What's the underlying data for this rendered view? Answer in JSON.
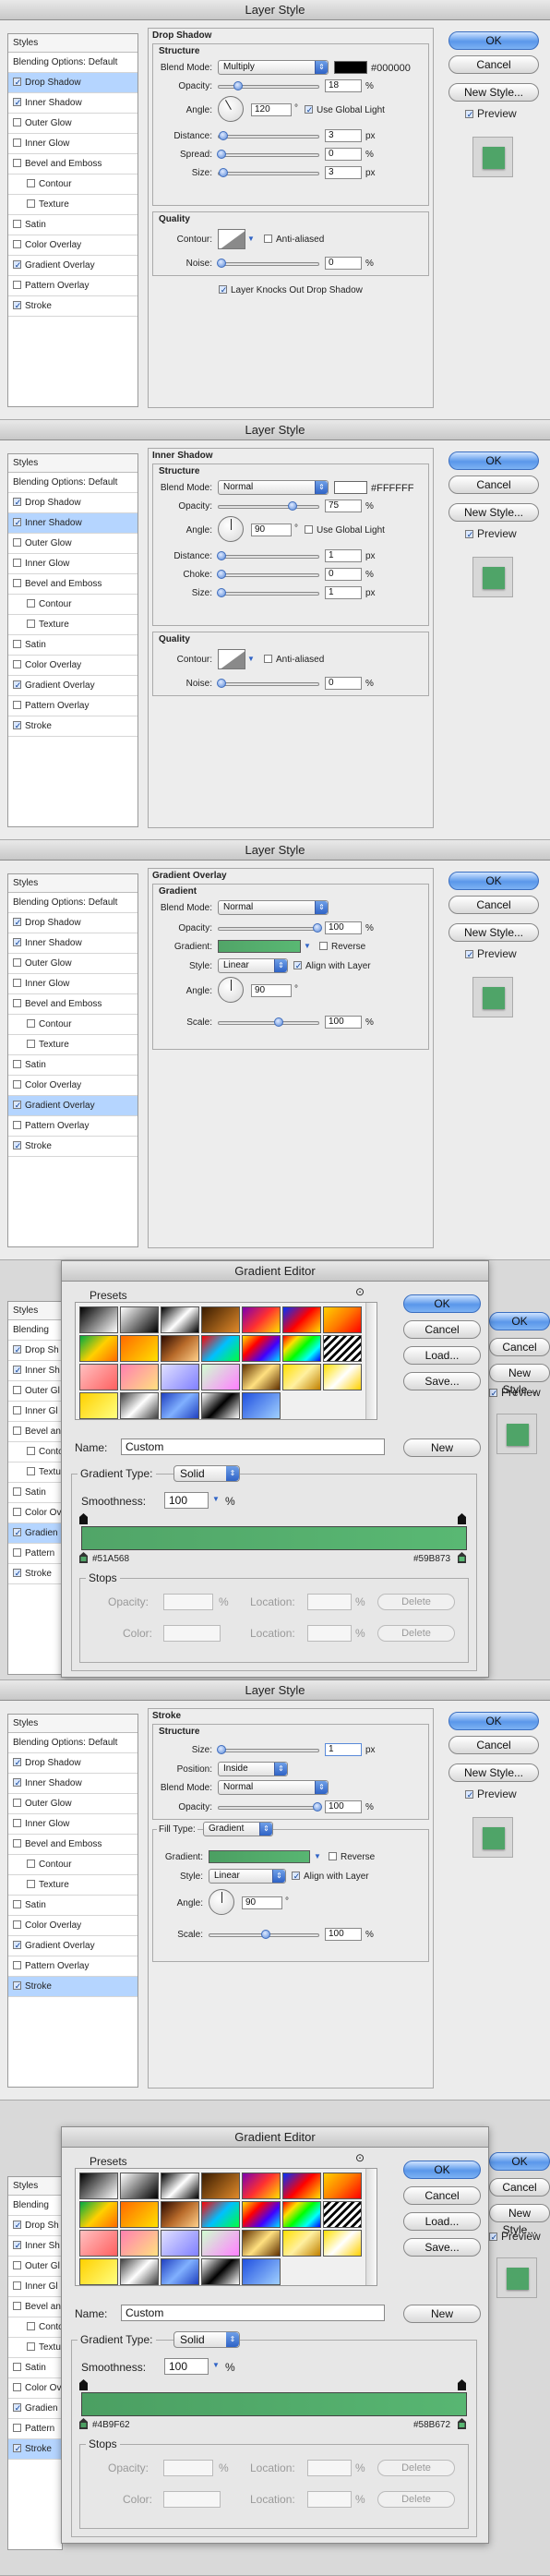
{
  "colors": {
    "green_start": "#51A568",
    "green_end": "#59B873",
    "green_start2": "#4B9F62",
    "green_end2": "#58B672",
    "selection": "#b5d5ff",
    "accent": "#5a97ea"
  },
  "window_title": "Layer Style",
  "styles_list": [
    {
      "label": "Styles",
      "checkbox": false,
      "header": true
    },
    {
      "label": "Blending Options: Default",
      "checkbox": false
    },
    {
      "label": "Drop Shadow",
      "checkbox": true
    },
    {
      "label": "Inner Shadow",
      "checkbox": true
    },
    {
      "label": "Outer Glow",
      "checkbox": true
    },
    {
      "label": "Inner Glow",
      "checkbox": true
    },
    {
      "label": "Bevel and Emboss",
      "checkbox": true
    },
    {
      "label": "Contour",
      "checkbox": true,
      "indent": true
    },
    {
      "label": "Texture",
      "checkbox": true,
      "indent": true
    },
    {
      "label": "Satin",
      "checkbox": true
    },
    {
      "label": "Color Overlay",
      "checkbox": true
    },
    {
      "label": "Gradient Overlay",
      "checkbox": true
    },
    {
      "label": "Pattern Overlay",
      "checkbox": true
    },
    {
      "label": "Stroke",
      "checkbox": true
    }
  ],
  "checked": [
    "Drop Shadow",
    "Inner Shadow",
    "Gradient Overlay",
    "Stroke"
  ],
  "buttons": {
    "ok": "OK",
    "cancel": "Cancel",
    "new_style": "New Style...",
    "preview": "Preview"
  },
  "drop_shadow": {
    "title": "Drop Shadow",
    "structure": "Structure",
    "blend_mode_label": "Blend Mode:",
    "blend_mode": "Multiply",
    "color_hex": "#000000",
    "opacity_label": "Opacity:",
    "opacity": "18",
    "opacity_pct": 18,
    "angle_label": "Angle:",
    "angle": "120",
    "deg": "°",
    "use_global": "Use Global Light",
    "distance_label": "Distance:",
    "distance": "3",
    "spread_label": "Spread:",
    "spread": "0",
    "size_label": "Size:",
    "size": "3",
    "px": "px",
    "pct": "%",
    "quality": "Quality",
    "contour_label": "Contour:",
    "anti_aliased": "Anti-aliased",
    "noise_label": "Noise:",
    "noise": "0",
    "knocks_out": "Layer Knocks Out Drop Shadow"
  },
  "inner_shadow": {
    "title": "Inner Shadow",
    "structure": "Structure",
    "blend_mode_label": "Blend Mode:",
    "blend_mode": "Normal",
    "color_hex": "#FFFFFF",
    "opacity_label": "Opacity:",
    "opacity": "75",
    "opacity_pct": 75,
    "angle_label": "Angle:",
    "angle": "90",
    "deg": "°",
    "use_global": "Use Global Light",
    "distance_label": "Distance:",
    "distance": "1",
    "choke_label": "Choke:",
    "choke": "0",
    "size_label": "Size:",
    "size": "1",
    "px": "px",
    "pct": "%",
    "quality": "Quality",
    "contour_label": "Contour:",
    "anti_aliased": "Anti-aliased",
    "noise_label": "Noise:",
    "noise": "0"
  },
  "gradient_overlay": {
    "title": "Gradient Overlay",
    "gradient_hdr": "Gradient",
    "blend_mode_label": "Blend Mode:",
    "blend_mode": "Normal",
    "opacity_label": "Opacity:",
    "opacity": "100",
    "gradient_label": "Gradient:",
    "reverse": "Reverse",
    "style_label": "Style:",
    "style": "Linear",
    "align": "Align with Layer",
    "angle_label": "Angle:",
    "angle": "90",
    "deg": "°",
    "scale_label": "Scale:",
    "scale": "100",
    "pct": "%"
  },
  "gradient_editor": {
    "title": "Gradient Editor",
    "presets": "Presets",
    "ok": "OK",
    "cancel": "Cancel",
    "load": "Load...",
    "save": "Save...",
    "name_label": "Name:",
    "name": "Custom",
    "new": "New",
    "type_label": "Gradient Type:",
    "type": "Solid",
    "smoothness_label": "Smoothness:",
    "smoothness": "100",
    "pct": "%",
    "stops": "Stops",
    "opacity_label": "Opacity:",
    "location_label": "Location:",
    "color_label": "Color:",
    "delete": "Delete"
  },
  "editor1": {
    "left_stop": "#51A568",
    "right_stop": "#59B873"
  },
  "editor2": {
    "left_stop": "#4B9F62",
    "right_stop": "#58B672"
  },
  "stroke": {
    "title": "Stroke",
    "structure": "Structure",
    "size_label": "Size:",
    "size": "1",
    "px": "px",
    "position_label": "Position:",
    "position": "Inside",
    "blend_mode_label": "Blend Mode:",
    "blend_mode": "Normal",
    "opacity_label": "Opacity:",
    "opacity": "100",
    "pct": "%",
    "fill_type_label": "Fill Type:",
    "fill_type": "Gradient",
    "gradient_label": "Gradient:",
    "reverse": "Reverse",
    "style_label": "Style:",
    "style": "Linear",
    "align": "Align with Layer",
    "angle_label": "Angle:",
    "angle": "90",
    "deg": "°",
    "scale_label": "Scale:",
    "scale": "100"
  },
  "partial_list": [
    "Styles",
    "Blending",
    "Drop Sh",
    "Inner Sh",
    "Outer Gl",
    "Inner Gl",
    "Bevel an",
    "Conto",
    "Textu",
    "Satin",
    "Color Ov",
    "Gradien",
    "Pattern",
    "Stroke"
  ]
}
